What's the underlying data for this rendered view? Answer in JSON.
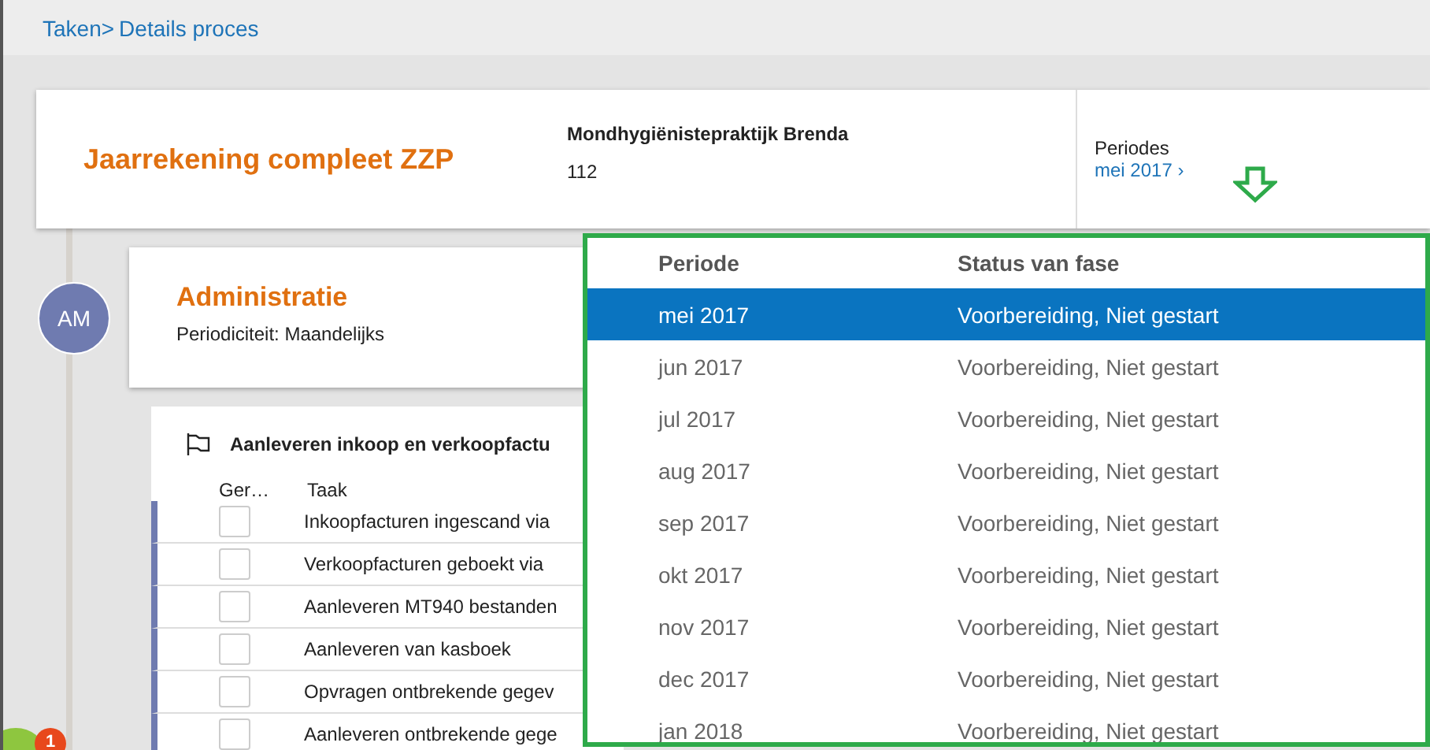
{
  "breadcrumb": {
    "parent": "Taken>",
    "current": "Details proces"
  },
  "process": {
    "title": "Jaarrekening compleet ZZP",
    "client": "Mondhygiënistepraktijk Brenda",
    "number": "112",
    "periods_label": "Periodes",
    "period": "mei 2017 ›"
  },
  "phase": {
    "avatar": "AM",
    "title": "Administratie",
    "periodicity": "Periodiciteit: Maandelijks"
  },
  "tasks": {
    "title": "Aanleveren inkoop en verkoopfactu",
    "columns": [
      "Ger…",
      "Taak"
    ],
    "rows": [
      {
        "checked": false,
        "task": "Inkoopfacturen ingescand via"
      },
      {
        "checked": false,
        "task": "Verkoopfacturen geboekt via"
      },
      {
        "checked": false,
        "task": "Aanleveren MT940 bestanden"
      },
      {
        "checked": false,
        "task": "Aanleveren van kasboek"
      },
      {
        "checked": false,
        "task": "Opvragen ontbrekende gegev"
      },
      {
        "checked": false,
        "task": "Aanleveren ontbrekende gege"
      }
    ]
  },
  "period_dropdown": {
    "columns": [
      "Periode",
      "Status van fase"
    ],
    "rows": [
      {
        "period": "mei 2017",
        "status": "Voorbereiding, Niet gestart",
        "selected": true
      },
      {
        "period": "jun 2017",
        "status": "Voorbereiding, Niet gestart",
        "selected": false
      },
      {
        "period": "jul 2017",
        "status": "Voorbereiding, Niet gestart",
        "selected": false
      },
      {
        "period": "aug 2017",
        "status": "Voorbereiding, Niet gestart",
        "selected": false
      },
      {
        "period": "sep 2017",
        "status": "Voorbereiding, Niet gestart",
        "selected": false
      },
      {
        "period": "okt 2017",
        "status": "Voorbereiding, Niet gestart",
        "selected": false
      },
      {
        "period": "nov 2017",
        "status": "Voorbereiding, Niet gestart",
        "selected": false
      },
      {
        "period": "dec 2017",
        "status": "Voorbereiding, Niet gestart",
        "selected": false
      },
      {
        "period": "jan 2018",
        "status": "Voorbereiding, Niet gestart",
        "selected": false
      }
    ]
  },
  "notification_badge": "1"
}
